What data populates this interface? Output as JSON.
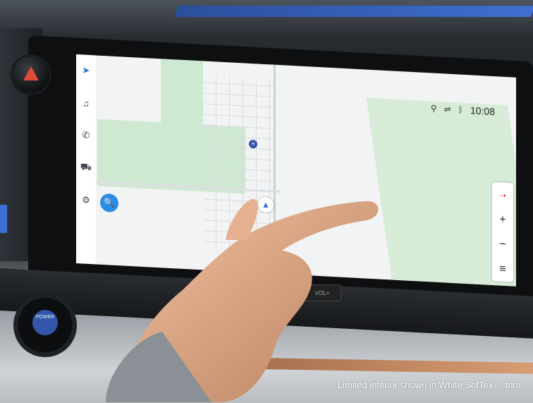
{
  "caption": "Limited interior shown in White SofTex®³ trim.",
  "screen": {
    "clock": "10:08",
    "status_icons": [
      "location-pin-icon",
      "network-icon",
      "bluetooth-icon"
    ],
    "rail_items": [
      {
        "name": "navigation-icon",
        "glyph": "➤",
        "active": true
      },
      {
        "name": "music-icon",
        "glyph": "♫",
        "active": false
      },
      {
        "name": "phone-icon",
        "glyph": "✆",
        "active": false
      },
      {
        "name": "car-icon",
        "glyph": "⛟",
        "active": false
      },
      {
        "name": "settings-icon",
        "glyph": "⚙",
        "active": false
      }
    ],
    "search_glyph": "🔍",
    "zoom_in": "+",
    "zoom_out": "−",
    "menu_glyph": "≡",
    "poi_label": "H"
  },
  "hardware": {
    "power_label": "POWER",
    "vol_label": "VOL+"
  },
  "colors": {
    "accent_blue": "#2b8be8",
    "hazard_red": "#e24b3b",
    "map_green": "#cfe8d2"
  }
}
